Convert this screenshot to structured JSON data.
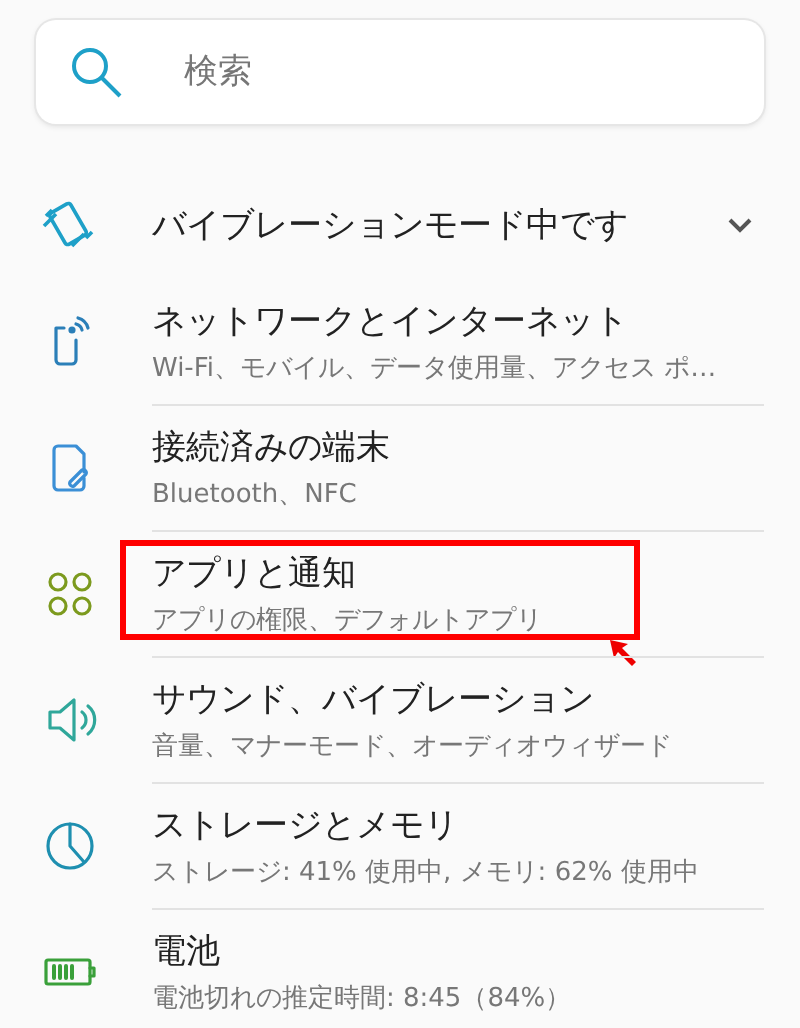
{
  "search": {
    "placeholder": "検索"
  },
  "status": {
    "label": "バイブレーションモード中です",
    "expanded": false
  },
  "items": [
    {
      "title": "ネットワークとインターネット",
      "summary": "Wi-Fi、モバイル、データ使用量、アクセス ポ…",
      "highlighted": false
    },
    {
      "title": "接続済みの端末",
      "summary": "Bluetooth、NFC",
      "highlighted": false
    },
    {
      "title": "アプリと通知",
      "summary": "アプリの権限、デフォルトアプリ",
      "highlighted": true
    },
    {
      "title": "サウンド、バイブレーション",
      "summary": "音量、マナーモード、オーディオウィザード",
      "highlighted": false
    },
    {
      "title": "ストレージとメモリ",
      "summary": "ストレージ: 41% 使用中, メモリ: 62% 使用中",
      "highlighted": false
    },
    {
      "title": "電池",
      "summary": "電池切れの推定時間: 8:45（84%）",
      "highlighted": false
    }
  ]
}
